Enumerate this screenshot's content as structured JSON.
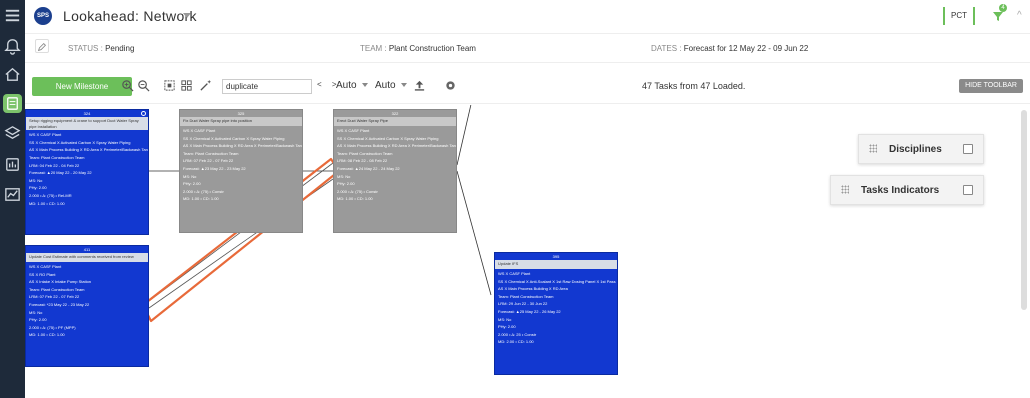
{
  "header": {
    "logo_text": "SPS",
    "title": "Lookahead: Network",
    "pct_label": "PCT",
    "filter_badge": "4"
  },
  "info": {
    "status_label": "STATUS",
    "status_value": "Pending",
    "team_label": "TEAM",
    "team_value": "Plant Construction Team",
    "dates_label": "DATES",
    "dates_value": "Forecast for 12 May 22 - 09 Jun 22"
  },
  "toolbar": {
    "new_milestone": "New Milestone",
    "search_value": "duplicate",
    "prev_next": "< >",
    "select1": "Auto",
    "select2": "Auto",
    "loaded_text": "47 Tasks from 47 Loaded.",
    "hide_toolbar": "HIDE TOOLBAR"
  },
  "cards": [
    {
      "id": "324",
      "color": "blue",
      "name": "Setup rigging equipment & crane to support Duct Water Spray pipe installation",
      "rows": [
        "WS X CASF Plant",
        "SS X Chemical X Activated Carbon X Spray Water Piping",
        "AS X Main Process Building X RD Area X Perimeter/Backwash Tanks",
        "Team: Plant Construction Team",
        "LRM: 04 Feb 22 - 04 Feb 22",
        "Forecast: ▲20 May 22 - 20 May 22",
        "MS: No",
        "PHy: 2.00",
        "2.000 • Δ: (75) • Rel-MR",
        "MD: 1.00 • CD: 1.00"
      ]
    },
    {
      "id": "325",
      "color": "gray",
      "name": "Fix Duct Water Spray pipe into position",
      "rows": [
        "WS X CASF Plant",
        "SS X Chemical X Activated Carbon X Spray Water Piping",
        "AS X Main Process Building X RD Area X Perimeter/Backwash Tanks",
        "Team: Plant Construction Team",
        "LRM: 07 Feb 22 - 07 Feb 22",
        "Forecast: ▲23 May 22 - 23 May 22",
        "MS: No",
        "PHy: 2.00",
        "2.000 • Δ: (75) • Constr",
        "MD: 1.00 • CD: 1.00"
      ]
    },
    {
      "id": "322",
      "color": "gray",
      "name": "Erect Duct Water Spray Pipe",
      "rows": [
        "WS X CASF Plant",
        "SS X Chemical X Activated Carbon X Spray Water Piping",
        "AS X Main Process Building X RD Area X Perimeter/Backwash Tanks",
        "Team: Plant Construction Team",
        "LRM: 08 Feb 22 - 08 Feb 22",
        "Forecast: ▲24 May 22 - 24 May 22",
        "MS: No",
        "PHy: 2.00",
        "2.000 • Δ: (75) • Constr",
        "MD: 1.00 • CD: 1.00"
      ]
    },
    {
      "id": "411",
      "color": "blue",
      "name": "Update Cost Estimate with comments received from review",
      "rows": [
        "WS X CASF Plant",
        "SS X RO Plant",
        "AS X Intake X Intake Pump Station",
        "Team: Plant Construction Team",
        "LRM: 07 Feb 22 - 07 Feb 22",
        "Forecast: *23 May 22 - 23 May 22",
        "MS: No",
        "PHy: 2.00",
        "2.000 • Δ: (75) • PF (MPP)",
        "MD: 1.00 • CD: 1.00"
      ]
    },
    {
      "id": "395",
      "color": "blue",
      "name": "Update IFS",
      "rows": [
        "WS X CASF Plant",
        "SS X Chemical X Anti-Scalant X 1st Raw Dosing Panel X 1st Pass Dilution Panel",
        "AS X Main Process Building X RD Area",
        "Team: Plant Construction Team",
        "LRM: 29 Jun 22 - 30 Jun 22",
        "Forecast: ▲25 May 22 - 26 May 22",
        "MS: No",
        "PHy: 2.00",
        "2.000 • Δ: 25 • Constr",
        "MD: 2.00 • CD: 1.00"
      ]
    }
  ],
  "panels": {
    "disciplines": "Disciplines",
    "tasks_indicators": "Tasks Indicators"
  },
  "colors": {
    "nav_bg": "#1e2a3a",
    "accent_green": "#6cbf5a",
    "card_blue": "#1238d0",
    "card_gray": "#9a9a9a",
    "highlight_orange": "#e86a3a"
  }
}
